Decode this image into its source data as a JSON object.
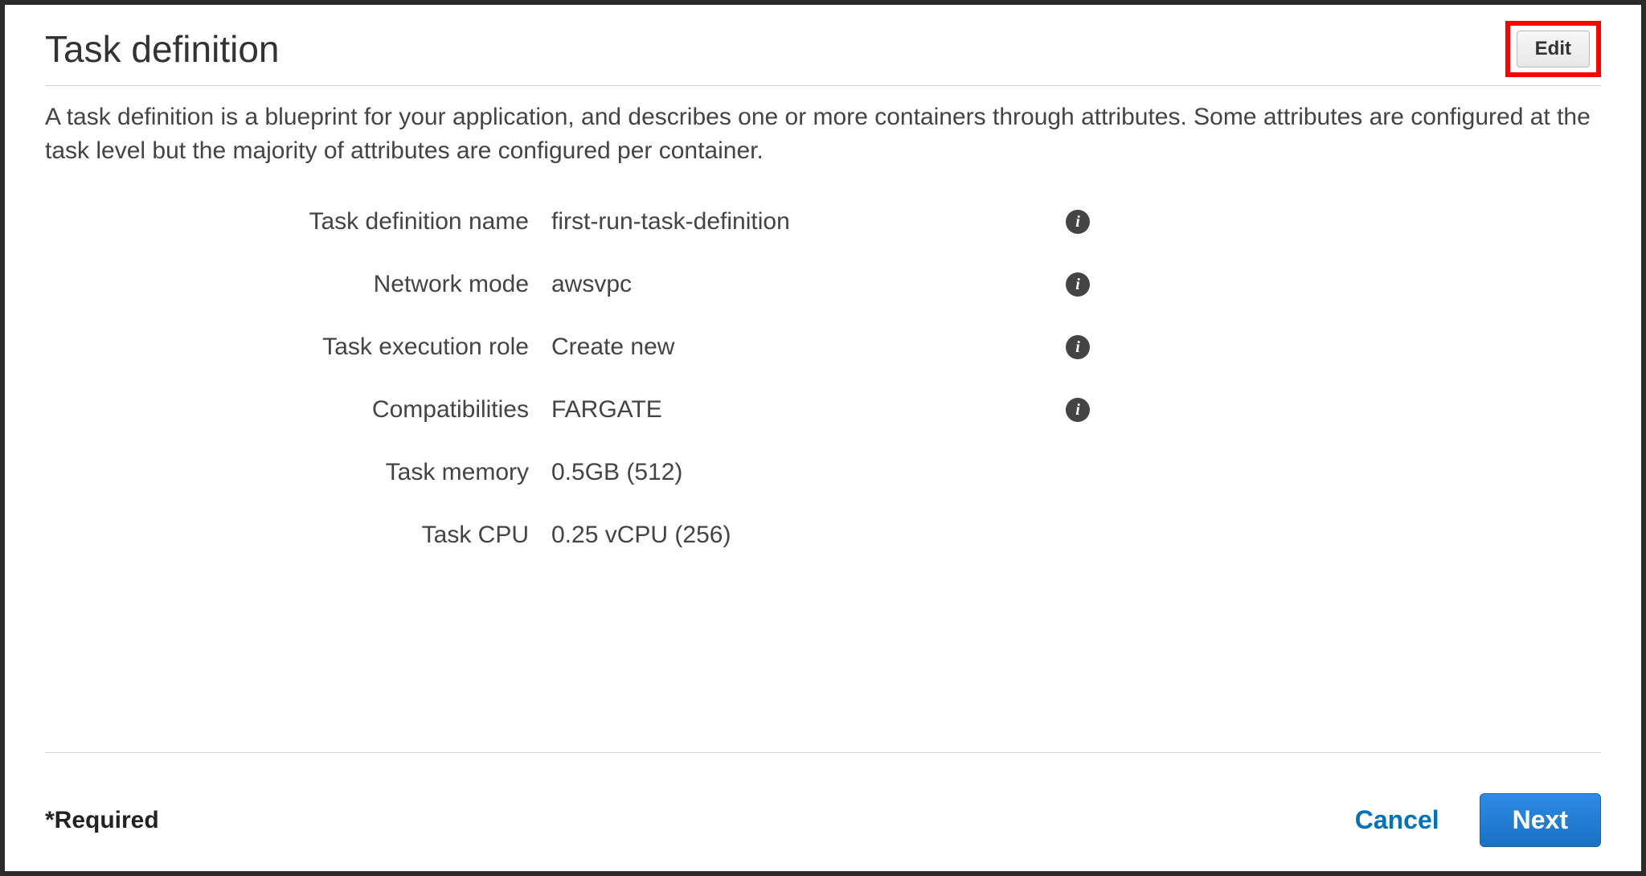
{
  "header": {
    "title": "Task definition",
    "edit_label": "Edit"
  },
  "description": "A task definition is a blueprint for your application, and describes one or more containers through attributes. Some attributes are configured at the task level but the majority of attributes are configured per container.",
  "fields": {
    "task_definition_name": {
      "label": "Task definition name",
      "value": "first-run-task-definition",
      "info": true
    },
    "network_mode": {
      "label": "Network mode",
      "value": "awsvpc",
      "info": true
    },
    "task_execution_role": {
      "label": "Task execution role",
      "value": "Create new",
      "info": true
    },
    "compatibilities": {
      "label": "Compatibilities",
      "value": "FARGATE",
      "info": true
    },
    "task_memory": {
      "label": "Task memory",
      "value": "0.5GB (512)",
      "info": false
    },
    "task_cpu": {
      "label": "Task CPU",
      "value": "0.25 vCPU (256)",
      "info": false
    }
  },
  "footer": {
    "required": "*Required",
    "cancel_label": "Cancel",
    "next_label": "Next"
  }
}
